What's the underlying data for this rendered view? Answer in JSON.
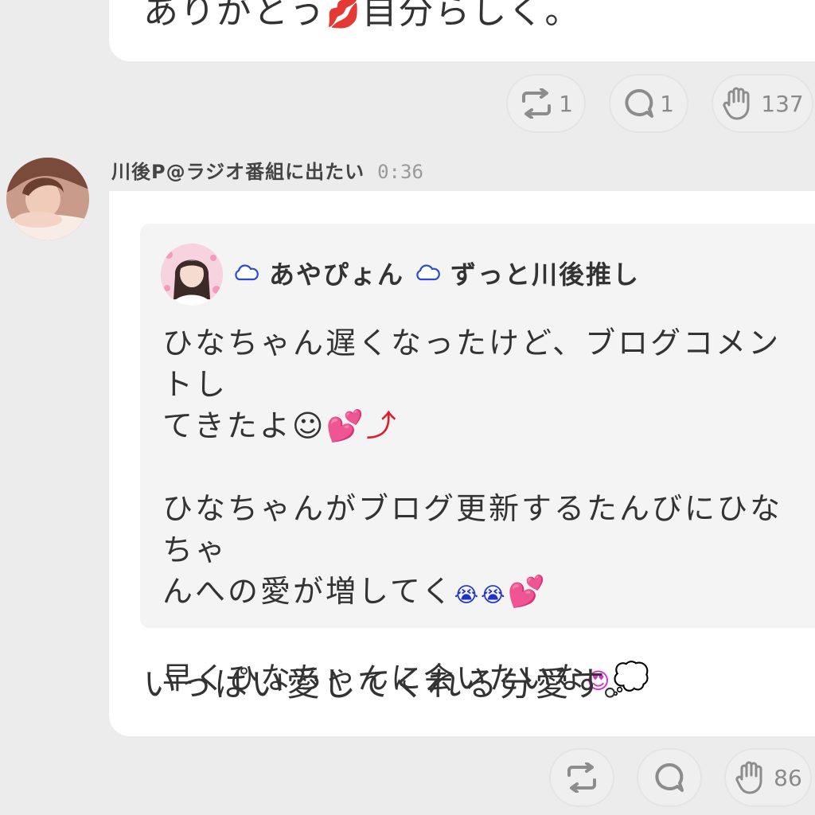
{
  "prev_message": {
    "text": "ありがとう",
    "emoji": "💋",
    "text_suffix": "自分らしく。",
    "reactions": {
      "retweet_count": "1",
      "reply_count": "1",
      "clap_count": "137"
    }
  },
  "message": {
    "sender_name": "川後P@ラジオ番組に出たい",
    "time": "0:36",
    "quote": {
      "author": "あやぴょん",
      "bio": "ずっと川後推し",
      "lines": [
        "ひなちゃん遅くなったけど、ブログコメントし",
        "てきたよ☺",
        "",
        "ひなちゃんがブログ更新するたんびにひなちゃ",
        "んへの愛が増してく",
        "",
        "早くひなちゃんに会いたいな"
      ],
      "emoji": {
        "heart": "💕",
        "arrow": "⤴",
        "cry": "😭",
        "love": "😍",
        "thought": "💭"
      }
    },
    "text": "いっぱい愛してくれる分愛す。",
    "reactions": {
      "clap_count": "86"
    }
  },
  "colors": {
    "background": "#ececec",
    "card": "#ffffff",
    "quote": "#f4f4f4",
    "icon": "#8c8c8c",
    "heart": "#e11b2a"
  }
}
